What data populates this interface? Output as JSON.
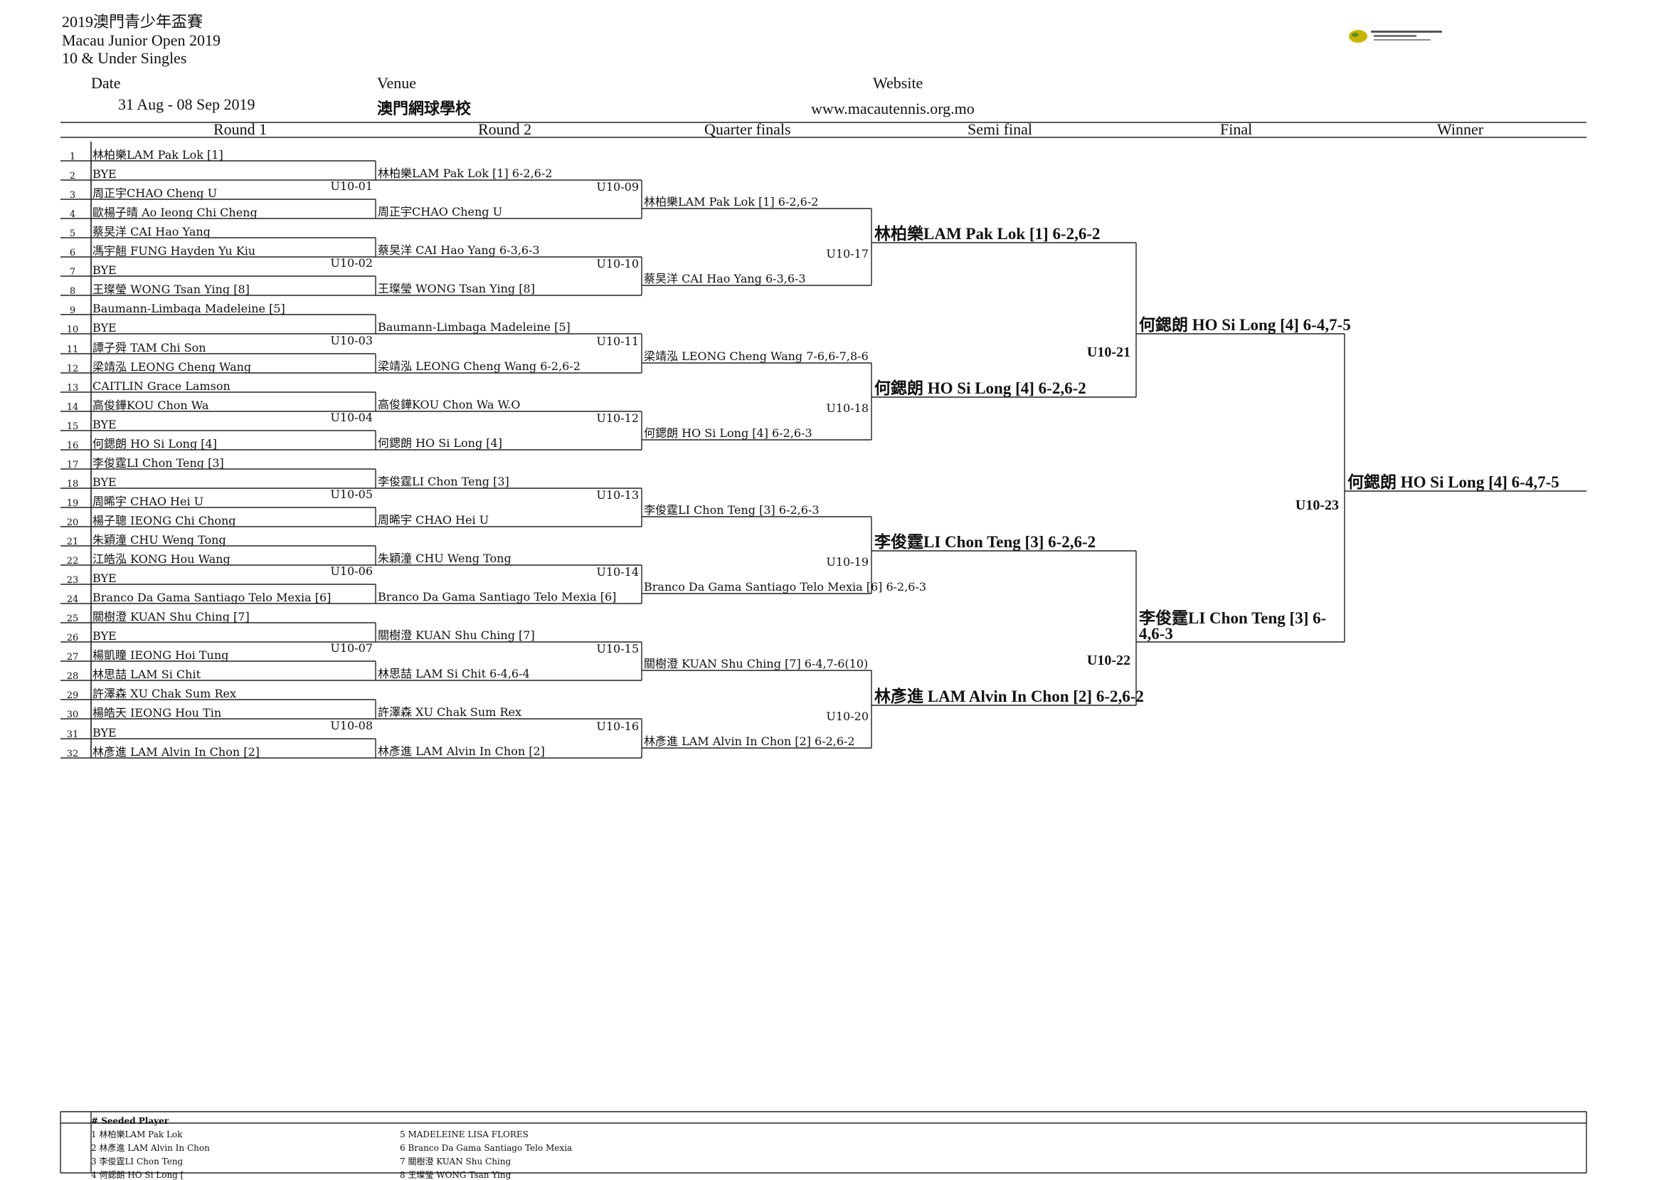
{
  "header": {
    "title_cn": "2019澳門青少年盃賽",
    "title_en": "Macau Junior Open 2019",
    "category": "10 & Under Singles",
    "date_label": "Date",
    "date_value": "31 Aug - 08 Sep 2019",
    "venue_label": "Venue",
    "venue_value": "澳門網球學校",
    "website_label": "Website",
    "website_value": "www.macautennis.org.mo"
  },
  "columns": [
    "Round 1",
    "Round 2",
    "Quarter finals",
    "Semi final",
    "Final",
    "Winner"
  ],
  "round1": [
    {
      "n": "1",
      "name": "林柏樂LAM Pak Lok [1]"
    },
    {
      "n": "2",
      "name": "BYE"
    },
    {
      "n": "3",
      "name": "周正宇CHAO Cheng U"
    },
    {
      "n": "4",
      "name": "歐楊子晴 Ao Ieong Chi Cheng"
    },
    {
      "n": "5",
      "name": "蔡旲洋 CAI Hao Yang"
    },
    {
      "n": "6",
      "name": "馮宇翹 FUNG Hayden Yu Kiu"
    },
    {
      "n": "7",
      "name": "BYE"
    },
    {
      "n": "8",
      "name": "王璨瑩 WONG Tsan Ying [8]"
    },
    {
      "n": "9",
      "name": "Baumann-Limbaga Madeleine [5]"
    },
    {
      "n": "10",
      "name": "BYE"
    },
    {
      "n": "11",
      "name": "譚子舜 TAM Chi Son"
    },
    {
      "n": "12",
      "name": "梁靖泓 LEONG Cheng Wang"
    },
    {
      "n": "13",
      "name": "CAITLIN Grace Lamson"
    },
    {
      "n": "14",
      "name": "高俊鏵KOU Chon Wa"
    },
    {
      "n": "15",
      "name": "BYE"
    },
    {
      "n": "16",
      "name": "何鍶朗 HO Si Long [4]"
    },
    {
      "n": "17",
      "name": "李俊霆LI Chon Teng [3]"
    },
    {
      "n": "18",
      "name": "BYE"
    },
    {
      "n": "19",
      "name": "周晞宇 CHAO Hei U"
    },
    {
      "n": "20",
      "name": "楊子聰 IEONG Chi Chong"
    },
    {
      "n": "21",
      "name": "朱穎潼 CHU Weng Tong"
    },
    {
      "n": "22",
      "name": "江皓泓 KONG Hou Wang"
    },
    {
      "n": "23",
      "name": "BYE"
    },
    {
      "n": "24",
      "name": "Branco Da Gama Santiago Telo Mexia [6]"
    },
    {
      "n": "25",
      "name": "關樹澄 KUAN Shu Ching [7]"
    },
    {
      "n": "26",
      "name": "BYE"
    },
    {
      "n": "27",
      "name": "楊凱瞳 IEONG Hoi Tung"
    },
    {
      "n": "28",
      "name": "林思喆 LAM Si Chit"
    },
    {
      "n": "29",
      "name": "許澤森 XU Chak Sum Rex"
    },
    {
      "n": "30",
      "name": "楊皓天 IEONG Hou Tin"
    },
    {
      "n": "31",
      "name": "BYE"
    },
    {
      "n": "32",
      "name": "林彥進 LAM Alvin In Chon [2]"
    }
  ],
  "round1_codes": [
    "U10-01",
    "U10-02",
    "U10-03",
    "U10-04",
    "U10-05",
    "U10-06",
    "U10-07",
    "U10-08"
  ],
  "round2": [
    "林柏樂LAM Pak Lok [1] 6-2,6-2",
    "周正宇CHAO Cheng U",
    "蔡旲洋 CAI Hao Yang 6-3,6-3",
    "王璨瑩 WONG Tsan Ying [8]",
    "Baumann-Limbaga Madeleine [5]",
    "梁靖泓 LEONG Cheng Wang 6-2,6-2",
    "高俊鏵KOU Chon Wa W.O",
    "何鍶朗 HO Si Long [4]",
    "李俊霆LI Chon Teng [3]",
    "周晞宇 CHAO Hei U",
    "朱穎潼 CHU Weng Tong",
    "Branco Da Gama Santiago Telo Mexia [6]",
    "關樹澄 KUAN Shu Ching [7]",
    "林思喆 LAM Si Chit 6-4,6-4",
    "許澤森 XU Chak Sum Rex",
    "林彥進 LAM Alvin In Chon [2]"
  ],
  "round2_codes": [
    "U10-09",
    "U10-10",
    "U10-11",
    "U10-12",
    "U10-13",
    "U10-14",
    "U10-15",
    "U10-16"
  ],
  "quarter": [
    "林柏樂LAM Pak Lok [1] 6-2,6-2",
    "蔡旲洋 CAI Hao Yang 6-3,6-3",
    "梁靖泓 LEONG Cheng Wang 7-6,6-7,8-6",
    "何鍶朗 HO Si Long [4] 6-2,6-3",
    "李俊霆LI Chon Teng [3] 6-2,6-3",
    "Branco Da Gama Santiago Telo Mexia [6] 6-2,6-3",
    "關樹澄 KUAN Shu Ching [7] 6-4,7-6(10)",
    "林彥進 LAM Alvin In Chon [2] 6-2,6-2"
  ],
  "quarter_codes": [
    "U10-17",
    "U10-18",
    "U10-19",
    "U10-20"
  ],
  "semi": [
    "林柏樂LAM Pak Lok [1] 6-2,6-2",
    "何鍶朗 HO Si Long [4] 6-2,6-2",
    "李俊霆LI Chon Teng [3] 6-2,6-2",
    "林彥進 LAM Alvin In Chon [2] 6-2,6-2"
  ],
  "semi_codes": [
    "U10-21",
    "U10-22"
  ],
  "final": [
    "何鍶朗 HO Si Long [4]   6-4,7-5",
    "李俊霆LI Chon Teng [3] 6-4,6-3"
  ],
  "final_code": "U10-23",
  "winner": "何鍶朗 HO Si Long [4]   6-4,7-5",
  "seeds": {
    "title": "# Seeded Player",
    "left": [
      "1 林柏樂LAM Pak Lok",
      "2 林彥進 LAM Alvin In Chon",
      "3 李俊霆LI Chon Teng",
      "4 何鍶朗 HO Si Long ["
    ],
    "right": [
      "5  MADELEINE LISA FLORES",
      "6 Branco Da Gama Santiago Telo Mexia",
      "7 關樹澄 KUAN Shu Ching",
      "8 王璨瑩 WONG Tsan Ying"
    ]
  },
  "colors": {
    "line": "#222222",
    "logo": "#c9b400"
  },
  "icons": {
    "logo": "association-logo-icon"
  }
}
